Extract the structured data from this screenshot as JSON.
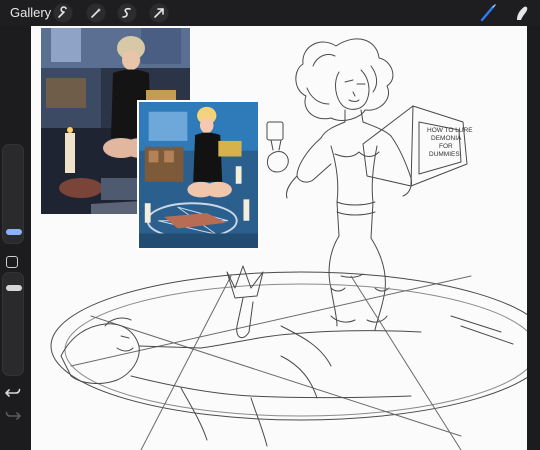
{
  "topbar": {
    "gallery_label": "Gallery",
    "tools_left": [
      "wrench-icon",
      "magic-wand-icon",
      "selection-icon",
      "transform-icon"
    ],
    "tools_right": [
      "brush-icon",
      "smudge-icon"
    ],
    "accent": "#2f7bf6"
  },
  "sidebar": {
    "controls": [
      "brush-size-slider",
      "modify-button",
      "opacity-slider",
      "undo-icon",
      "redo-icon"
    ]
  },
  "canvas": {
    "book_text": [
      "HOW TO LURE",
      "DEMONIA",
      "FOR",
      "DUMMIES"
    ]
  }
}
